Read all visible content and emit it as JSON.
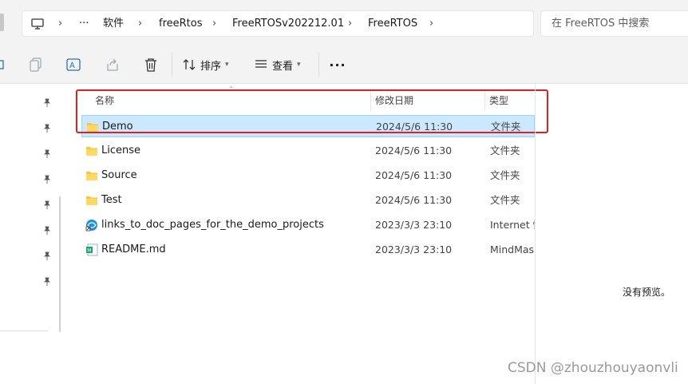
{
  "address_bar": {
    "crumbs": [
      "软件",
      "freeRtos",
      "FreeRTOSv202212.01",
      "FreeRTOS"
    ],
    "more_label": "···"
  },
  "search": {
    "placeholder": "在 FreeRTOS 中搜索"
  },
  "command_bar": {
    "sort_label": "排序",
    "view_label": "查看",
    "more_label": "···"
  },
  "columns": {
    "name": "名称",
    "date": "修改日期",
    "type": "类型"
  },
  "files": [
    {
      "name": "Demo",
      "date": "2024/5/6 11:30",
      "type": "文件夹",
      "icon": "folder-icon",
      "selected": true
    },
    {
      "name": "License",
      "date": "2024/5/6 11:30",
      "type": "文件夹",
      "icon": "folder-icon"
    },
    {
      "name": "Source",
      "date": "2024/5/6 11:30",
      "type": "文件夹",
      "icon": "folder-icon"
    },
    {
      "name": "Test",
      "date": "2024/5/6 11:30",
      "type": "文件夹",
      "icon": "folder-icon"
    },
    {
      "name": "links_to_doc_pages_for_the_demo_projects",
      "date": "2023/3/3 23:10",
      "type": "Internet 快",
      "icon": "internet-shortcut-icon"
    },
    {
      "name": "README.md",
      "date": "2023/3/3 23:10",
      "type": "MindMas",
      "icon": "mindmaster-file-icon"
    }
  ],
  "preview": {
    "message": "没有预览。"
  },
  "watermark": "CSDN @zhouzhouyaonvli",
  "colors": {
    "selection": "#cce8ff",
    "highlight_box": "#e02020",
    "folder": "#f8c64a"
  }
}
